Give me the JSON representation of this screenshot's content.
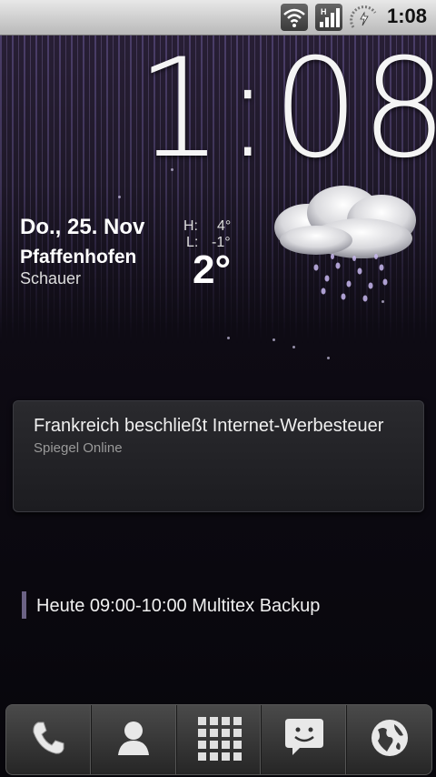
{
  "status_bar": {
    "time": "1:08",
    "icons": [
      "wifi-icon",
      "signal-icon",
      "battery-charging-icon"
    ]
  },
  "clock": {
    "time": "1:08"
  },
  "weather": {
    "date": "Do., 25. Nov",
    "city": "Pfaffenhofen",
    "condition": "Schauer",
    "high_label": "H:",
    "high_value": "4°",
    "low_label": "L:",
    "low_value": "-1°",
    "current_temp": "2°",
    "icon": "rain-cloud-icon"
  },
  "news": {
    "headline": "Frankreich beschließt Internet-Werbesteuer",
    "source": "Spiegel Online"
  },
  "calendar": {
    "event": "Heute 09:00-10:00 Multitex Backup"
  },
  "dock": {
    "buttons": [
      "phone-icon",
      "contacts-icon",
      "app-drawer-icon",
      "messaging-icon",
      "browser-icon"
    ]
  }
}
